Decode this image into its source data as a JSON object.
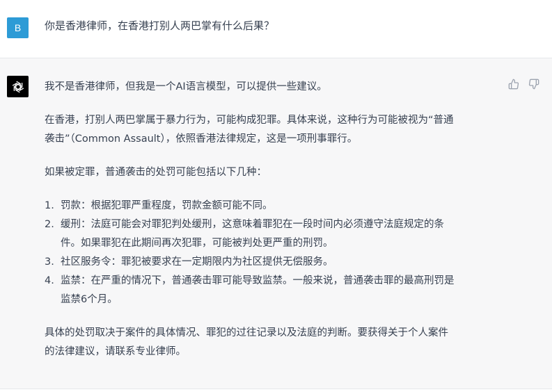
{
  "user_message": {
    "avatar_letter": "B",
    "text": "你是香港律师，在香港打别人两巴掌有什么后果？"
  },
  "assistant_message": {
    "avatar_icon": "openai-logo-icon",
    "paragraphs": {
      "intro": "我不是香港律师，但我是一个AI语言模型，可以提供一些建议。",
      "context_line1": "在香港，打别人两巴掌属于暴力行为，可能构成犯罪。具体来说，这种行为可能被视为“普通",
      "context_line2": "袭击”（Common Assault），依照香港法律规定，这是一项刑事罪行。",
      "lead_in": "如果被定罪，普通袭击的处罚可能包括以下几种：",
      "closing_line1": "具体的处罚取决于案件的具体情况、罪犯的过往记录以及法庭的判断。要获得关于个人案件",
      "closing_line2": "的法律建议，请联系专业律师。"
    },
    "list": [
      {
        "num": "1.",
        "lines": [
          "罚款：根据犯罪严重程度，罚款金额可能不同。"
        ]
      },
      {
        "num": "2.",
        "lines": [
          "缓刑：法庭可能会对罪犯判处缓刑，这意味着罪犯在一段时间内必须遵守法庭规定的条",
          "件。如果罪犯在此期间再次犯罪，可能被判处更严重的刑罚。"
        ]
      },
      {
        "num": "3.",
        "lines": [
          "社区服务令：罪犯被要求在一定期限内为社区提供无偿服务。"
        ]
      },
      {
        "num": "4.",
        "lines": [
          "监禁：在严重的情况下，普通袭击罪可能导致监禁。一般来说，普通袭击罪的最高刑罚是",
          "监禁6个月。"
        ]
      }
    ],
    "feedback": {
      "thumbs_up_icon": "thumbs-up-icon",
      "thumbs_down_icon": "thumbs-down-icon"
    }
  },
  "colors": {
    "user_avatar_bg": "#2d9bd6",
    "assistant_bg": "#f7f7f8",
    "text": "#374151",
    "icon": "#9ca3af"
  }
}
